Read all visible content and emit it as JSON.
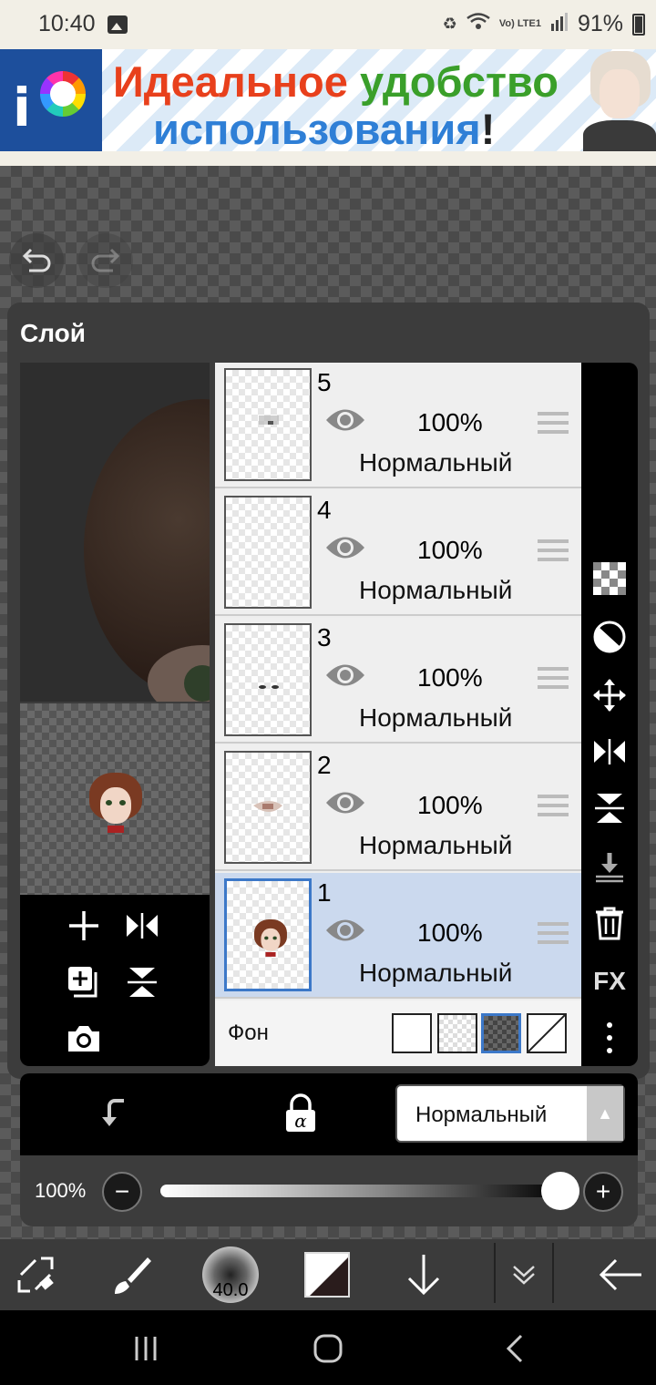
{
  "status_bar": {
    "time": "10:40",
    "lte": "Vo) LTE1",
    "battery": "91%"
  },
  "ad": {
    "line1_red": "Идеальное",
    "line1_green": "удобство",
    "line2": "использования",
    "exclamation": "!"
  },
  "panel": {
    "title": "Слой"
  },
  "layers": [
    {
      "number": "5",
      "opacity": "100%",
      "blend": "Нормальный"
    },
    {
      "number": "4",
      "opacity": "100%",
      "blend": "Нормальный"
    },
    {
      "number": "3",
      "opacity": "100%",
      "blend": "Нормальный"
    },
    {
      "number": "2",
      "opacity": "100%",
      "blend": "Нормальный"
    },
    {
      "number": "1",
      "opacity": "100%",
      "blend": "Нормальный",
      "selected": true
    }
  ],
  "background": {
    "label": "Фон",
    "options": [
      "white",
      "transparent",
      "dark-checker",
      "none"
    ],
    "selected": "dark-checker"
  },
  "side_tools": [
    "checker-icon",
    "contrast-icon",
    "move-icon",
    "flip-horizontal-icon",
    "flip-vertical-icon",
    "merge-down-icon",
    "trash-icon",
    "FX",
    "more-vertical-icon"
  ],
  "blend_bar": {
    "mode": "Нормальный"
  },
  "opacity_bar": {
    "value": "100%",
    "level": 0.95
  },
  "toolbar": {
    "brush_size": "40.0",
    "color": "#2a1c1c"
  },
  "colors": {
    "accent": "#3c78c8",
    "panel": "#3c3c3c",
    "selected_row": "#cbd9ee"
  }
}
